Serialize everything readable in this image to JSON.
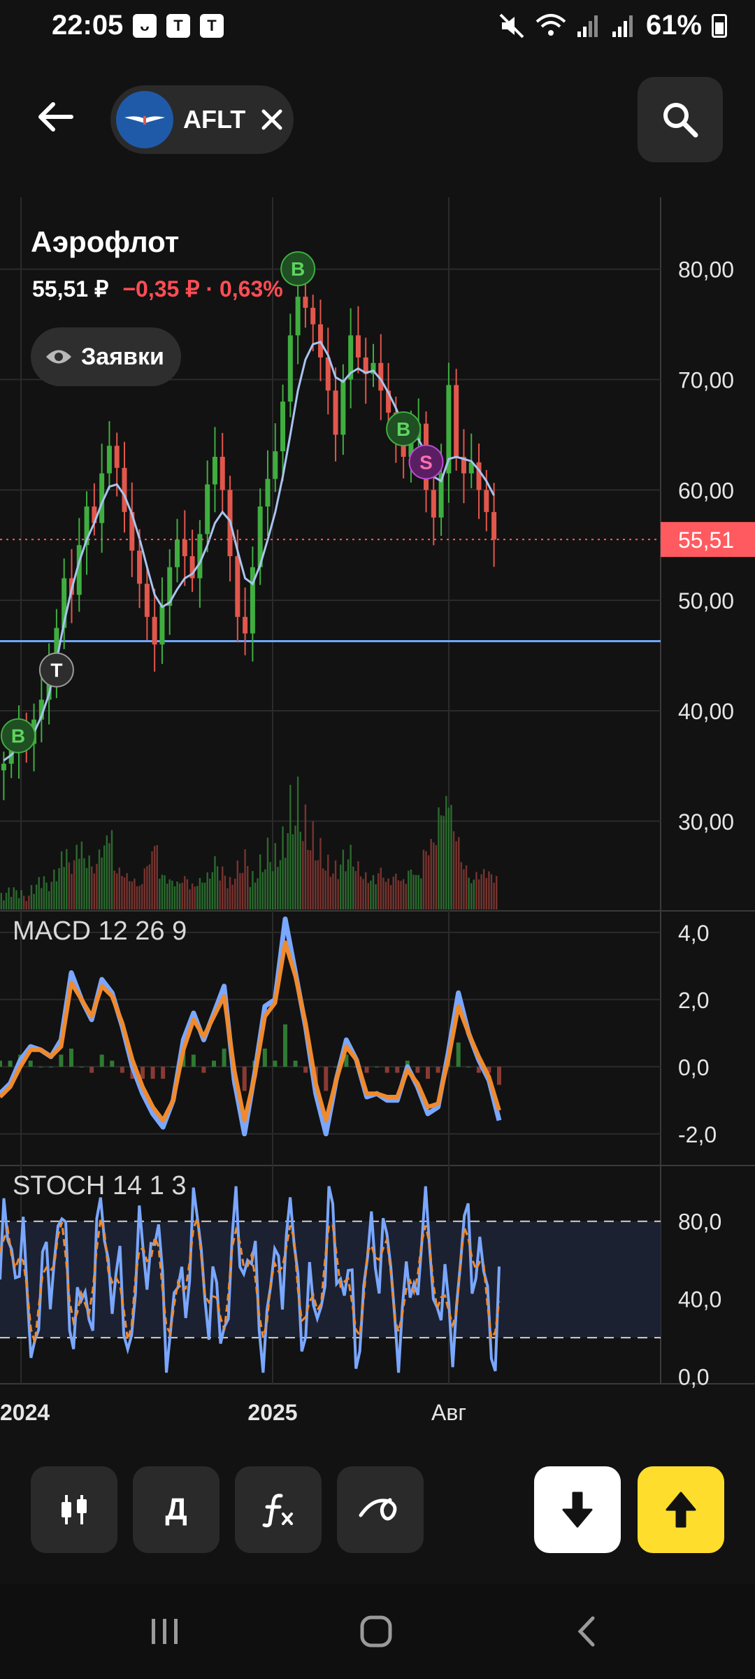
{
  "status_bar": {
    "time": "22:05",
    "app_icons": [
      "ᴗ",
      "T",
      "T"
    ],
    "battery": "61%"
  },
  "header": {
    "ticker": "AFLT"
  },
  "instrument": {
    "name": "Аэрофлот",
    "price": "55,51 ₽",
    "change": "−0,35 ₽ · 0,63%",
    "orders_label": "Заявки"
  },
  "colors": {
    "up": "#3fae3f",
    "down": "#e2574c",
    "ma": "#a9c4ee",
    "macd": "#7aa7ff",
    "signal": "#f08a2c",
    "accent": "#ffdd2d",
    "price_tag": "#ff5a5f"
  },
  "chart_data": [
    {
      "type": "candlestick",
      "title": "",
      "y_ticks": [
        "80,00",
        "70,00",
        "60,00",
        "50,00",
        "40,00",
        "30,00"
      ],
      "ylim": [
        22,
        86
      ],
      "last_price_label": "55,51",
      "last_price": 55.51,
      "support_level": 46.3,
      "x_ticks": [
        "2024",
        "2025",
        "Авг"
      ],
      "close_series": [
        35.2,
        36.5,
        37.8,
        37.0,
        39.2,
        41.0,
        43.5,
        47.5,
        52.0,
        50.5,
        55.0,
        58.5,
        57.0,
        61.5,
        64.0,
        62.0,
        58.0,
        54.5,
        51.5,
        48.5,
        46.0,
        49.5,
        53.0,
        55.5,
        54.0,
        52.0,
        56.0,
        60.5,
        63.0,
        60.0,
        54.0,
        48.5,
        47.0,
        53.0,
        58.5,
        61.0,
        63.5,
        68.0,
        74.0,
        77.5,
        76.5,
        75.0,
        72.0,
        69.0,
        65.0,
        70.0,
        74.0,
        72.0,
        70.5,
        71.5,
        69.0,
        67.0,
        65.0,
        63.0,
        64.5,
        66.0,
        60.0,
        57.5,
        61.5,
        69.5,
        63.0,
        61.5,
        62.5,
        60.0,
        58.0,
        55.5
      ],
      "ma_series": [
        35.5,
        36.0,
        36.8,
        37.2,
        38.0,
        39.5,
        41.5,
        44.5,
        48.0,
        51.0,
        53.5,
        55.5,
        57.0,
        58.8,
        60.3,
        60.5,
        59.5,
        57.8,
        55.6,
        53.0,
        50.5,
        49.4,
        49.8,
        51.0,
        52.0,
        52.4,
        53.4,
        55.0,
        57.0,
        58.0,
        57.2,
        54.5,
        52.0,
        51.5,
        53.2,
        55.5,
        58.0,
        61.2,
        65.0,
        69.0,
        71.8,
        73.2,
        73.4,
        72.2,
        70.2,
        69.8,
        70.6,
        71.0,
        70.6,
        70.8,
        70.0,
        68.8,
        67.4,
        65.8,
        64.8,
        64.6,
        63.2,
        61.2,
        60.8,
        62.8,
        63.0,
        62.8,
        62.6,
        61.8,
        60.8,
        59.5
      ],
      "volume_series": [
        6,
        8,
        7,
        5,
        9,
        12,
        10,
        15,
        22,
        18,
        25,
        20,
        17,
        24,
        30,
        16,
        14,
        12,
        10,
        18,
        26,
        14,
        12,
        11,
        13,
        10,
        12,
        14,
        20,
        16,
        12,
        18,
        22,
        14,
        20,
        26,
        24,
        30,
        45,
        48,
        38,
        32,
        26,
        20,
        18,
        22,
        24,
        18,
        14,
        13,
        16,
        12,
        14,
        12,
        16,
        14,
        24,
        28,
        40,
        44,
        30,
        18,
        12,
        14,
        15,
        13
      ],
      "markers": [
        {
          "label": "B",
          "kind": "buy",
          "index": 0
        },
        {
          "label": "T",
          "kind": "tag",
          "index": 7
        },
        {
          "label": "B",
          "kind": "buy",
          "index": 39
        },
        {
          "label": "B",
          "kind": "buy",
          "index": 53
        },
        {
          "label": "S",
          "kind": "sell",
          "index": 56
        }
      ]
    },
    {
      "type": "line",
      "title": "MACD 12 26 9",
      "y_ticks": [
        "4,0",
        "2,0",
        "0,0",
        "-2,0"
      ],
      "ylim": [
        -2.9,
        4.6
      ],
      "series": [
        {
          "values": [
            -0.8,
            -0.5,
            0.2,
            0.6,
            0.5,
            0.3,
            0.8,
            2.8,
            2.0,
            1.4,
            2.6,
            2.2,
            1.2,
            0.0,
            -0.8,
            -1.4,
            -1.8,
            -1.0,
            0.8,
            1.6,
            0.8,
            1.6,
            2.4,
            -0.4,
            -2.0,
            -0.2,
            1.8,
            2.0,
            4.4,
            2.8,
            1.2,
            -0.8,
            -2.0,
            -0.4,
            0.8,
            0.2,
            -0.9,
            -0.8,
            -1.0,
            -1.0,
            0.0,
            -0.6,
            -1.4,
            -1.2,
            0.4,
            2.2,
            1.0,
            0.2,
            -0.4,
            -1.6
          ]
        },
        {
          "values": [
            -0.9,
            -0.6,
            0.0,
            0.5,
            0.5,
            0.3,
            0.6,
            2.5,
            2.0,
            1.5,
            2.4,
            2.1,
            1.3,
            0.2,
            -0.6,
            -1.2,
            -1.6,
            -1.0,
            0.5,
            1.4,
            0.9,
            1.5,
            2.1,
            -0.1,
            -1.6,
            -0.3,
            1.5,
            1.9,
            3.7,
            2.7,
            1.3,
            -0.5,
            -1.6,
            -0.4,
            0.6,
            0.2,
            -0.8,
            -0.8,
            -0.9,
            -0.9,
            -0.1,
            -0.5,
            -1.2,
            -1.1,
            0.2,
            1.8,
            1.0,
            0.3,
            -0.3,
            -1.3
          ]
        }
      ]
    },
    {
      "type": "line",
      "title": "STOCH 14 1 3",
      "y_ticks": [
        "80,0",
        "40,0",
        "0,0"
      ],
      "ylim": [
        -3,
        108
      ],
      "levels": [
        80,
        20
      ]
    }
  ],
  "toolbar": {
    "chart_type_label": "candles",
    "timeframe_label": "Д",
    "indicators_label": "fx",
    "drawing_label": "draw"
  }
}
